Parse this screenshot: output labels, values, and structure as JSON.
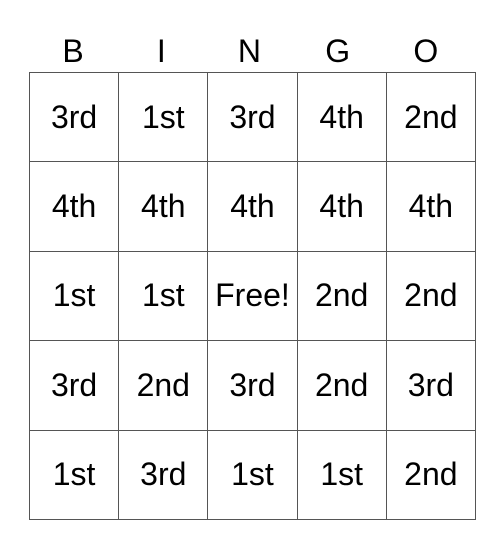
{
  "header": [
    "B",
    "I",
    "N",
    "G",
    "O"
  ],
  "board": [
    [
      "3rd",
      "1st",
      "3rd",
      "4th",
      "2nd"
    ],
    [
      "4th",
      "4th",
      "4th",
      "4th",
      "4th"
    ],
    [
      "1st",
      "1st",
      "Free!",
      "2nd",
      "2nd"
    ],
    [
      "3rd",
      "2nd",
      "3rd",
      "2nd",
      "3rd"
    ],
    [
      "1st",
      "3rd",
      "1st",
      "1st",
      "2nd"
    ]
  ]
}
